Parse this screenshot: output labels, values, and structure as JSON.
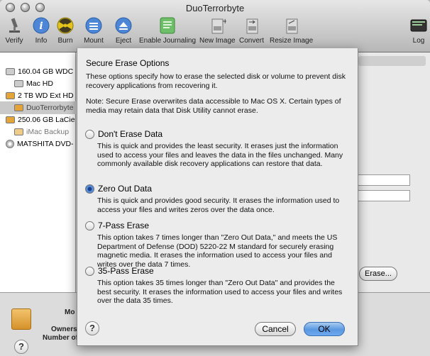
{
  "window": {
    "title": "DuoTerrorbyte"
  },
  "toolbar": {
    "verify": "Verify",
    "info": "Info",
    "burn": "Burn",
    "mount": "Mount",
    "eject": "Eject",
    "journaling": "Enable Journaling",
    "new_image": "New Image",
    "convert": "Convert",
    "resize_image": "Resize Image",
    "log": "Log"
  },
  "sidebar": {
    "items": [
      {
        "label": "160.04 GB WDC"
      },
      {
        "label": "Mac HD"
      },
      {
        "label": "2 TB WD Ext HD"
      },
      {
        "label": "DuoTerrorbyte"
      },
      {
        "label": "250.06 GB LaCie"
      },
      {
        "label": "iMac Backup"
      },
      {
        "label": "MATSHITA DVD-"
      }
    ]
  },
  "background": {
    "erase_button": "Erase...",
    "info_line1": "Mo",
    "info_owners": "Owners",
    "info_number": "Number of"
  },
  "sheet": {
    "title": "Secure Erase Options",
    "intro": "These options specify how to erase the selected disk or volume to prevent disk recovery applications from recovering it.",
    "note": "Note: Secure Erase overwrites data accessible to Mac OS X.  Certain types of media may retain data that Disk Utility cannot erase.",
    "options": [
      {
        "label": "Don't Erase Data",
        "selected": false,
        "desc": "This is quick and provides the least security. It erases just the information used to access your files and leaves the data in the files unchanged. Many commonly available disk recovery applications can restore that data."
      },
      {
        "label": "Zero Out Data",
        "selected": true,
        "desc": "This is quick and provides good security. It erases the information used to access your files and writes zeros over the data once."
      },
      {
        "label": "7-Pass Erase",
        "selected": false,
        "desc": "This option takes 7 times longer than \"Zero Out Data,\" and meets the US Department of Defense (DOD) 5220-22 M standard for securely erasing magnetic media. It erases the information used to access your files and writes over the data 7 times."
      },
      {
        "label": "35-Pass Erase",
        "selected": false,
        "desc": "This option takes 35 times longer than \"Zero Out Data\" and provides the best security. It erases the information used to access your files and writes over the data 35 times."
      }
    ],
    "help": "?",
    "cancel": "Cancel",
    "ok": "OK"
  },
  "bottom": {
    "help": "?"
  }
}
